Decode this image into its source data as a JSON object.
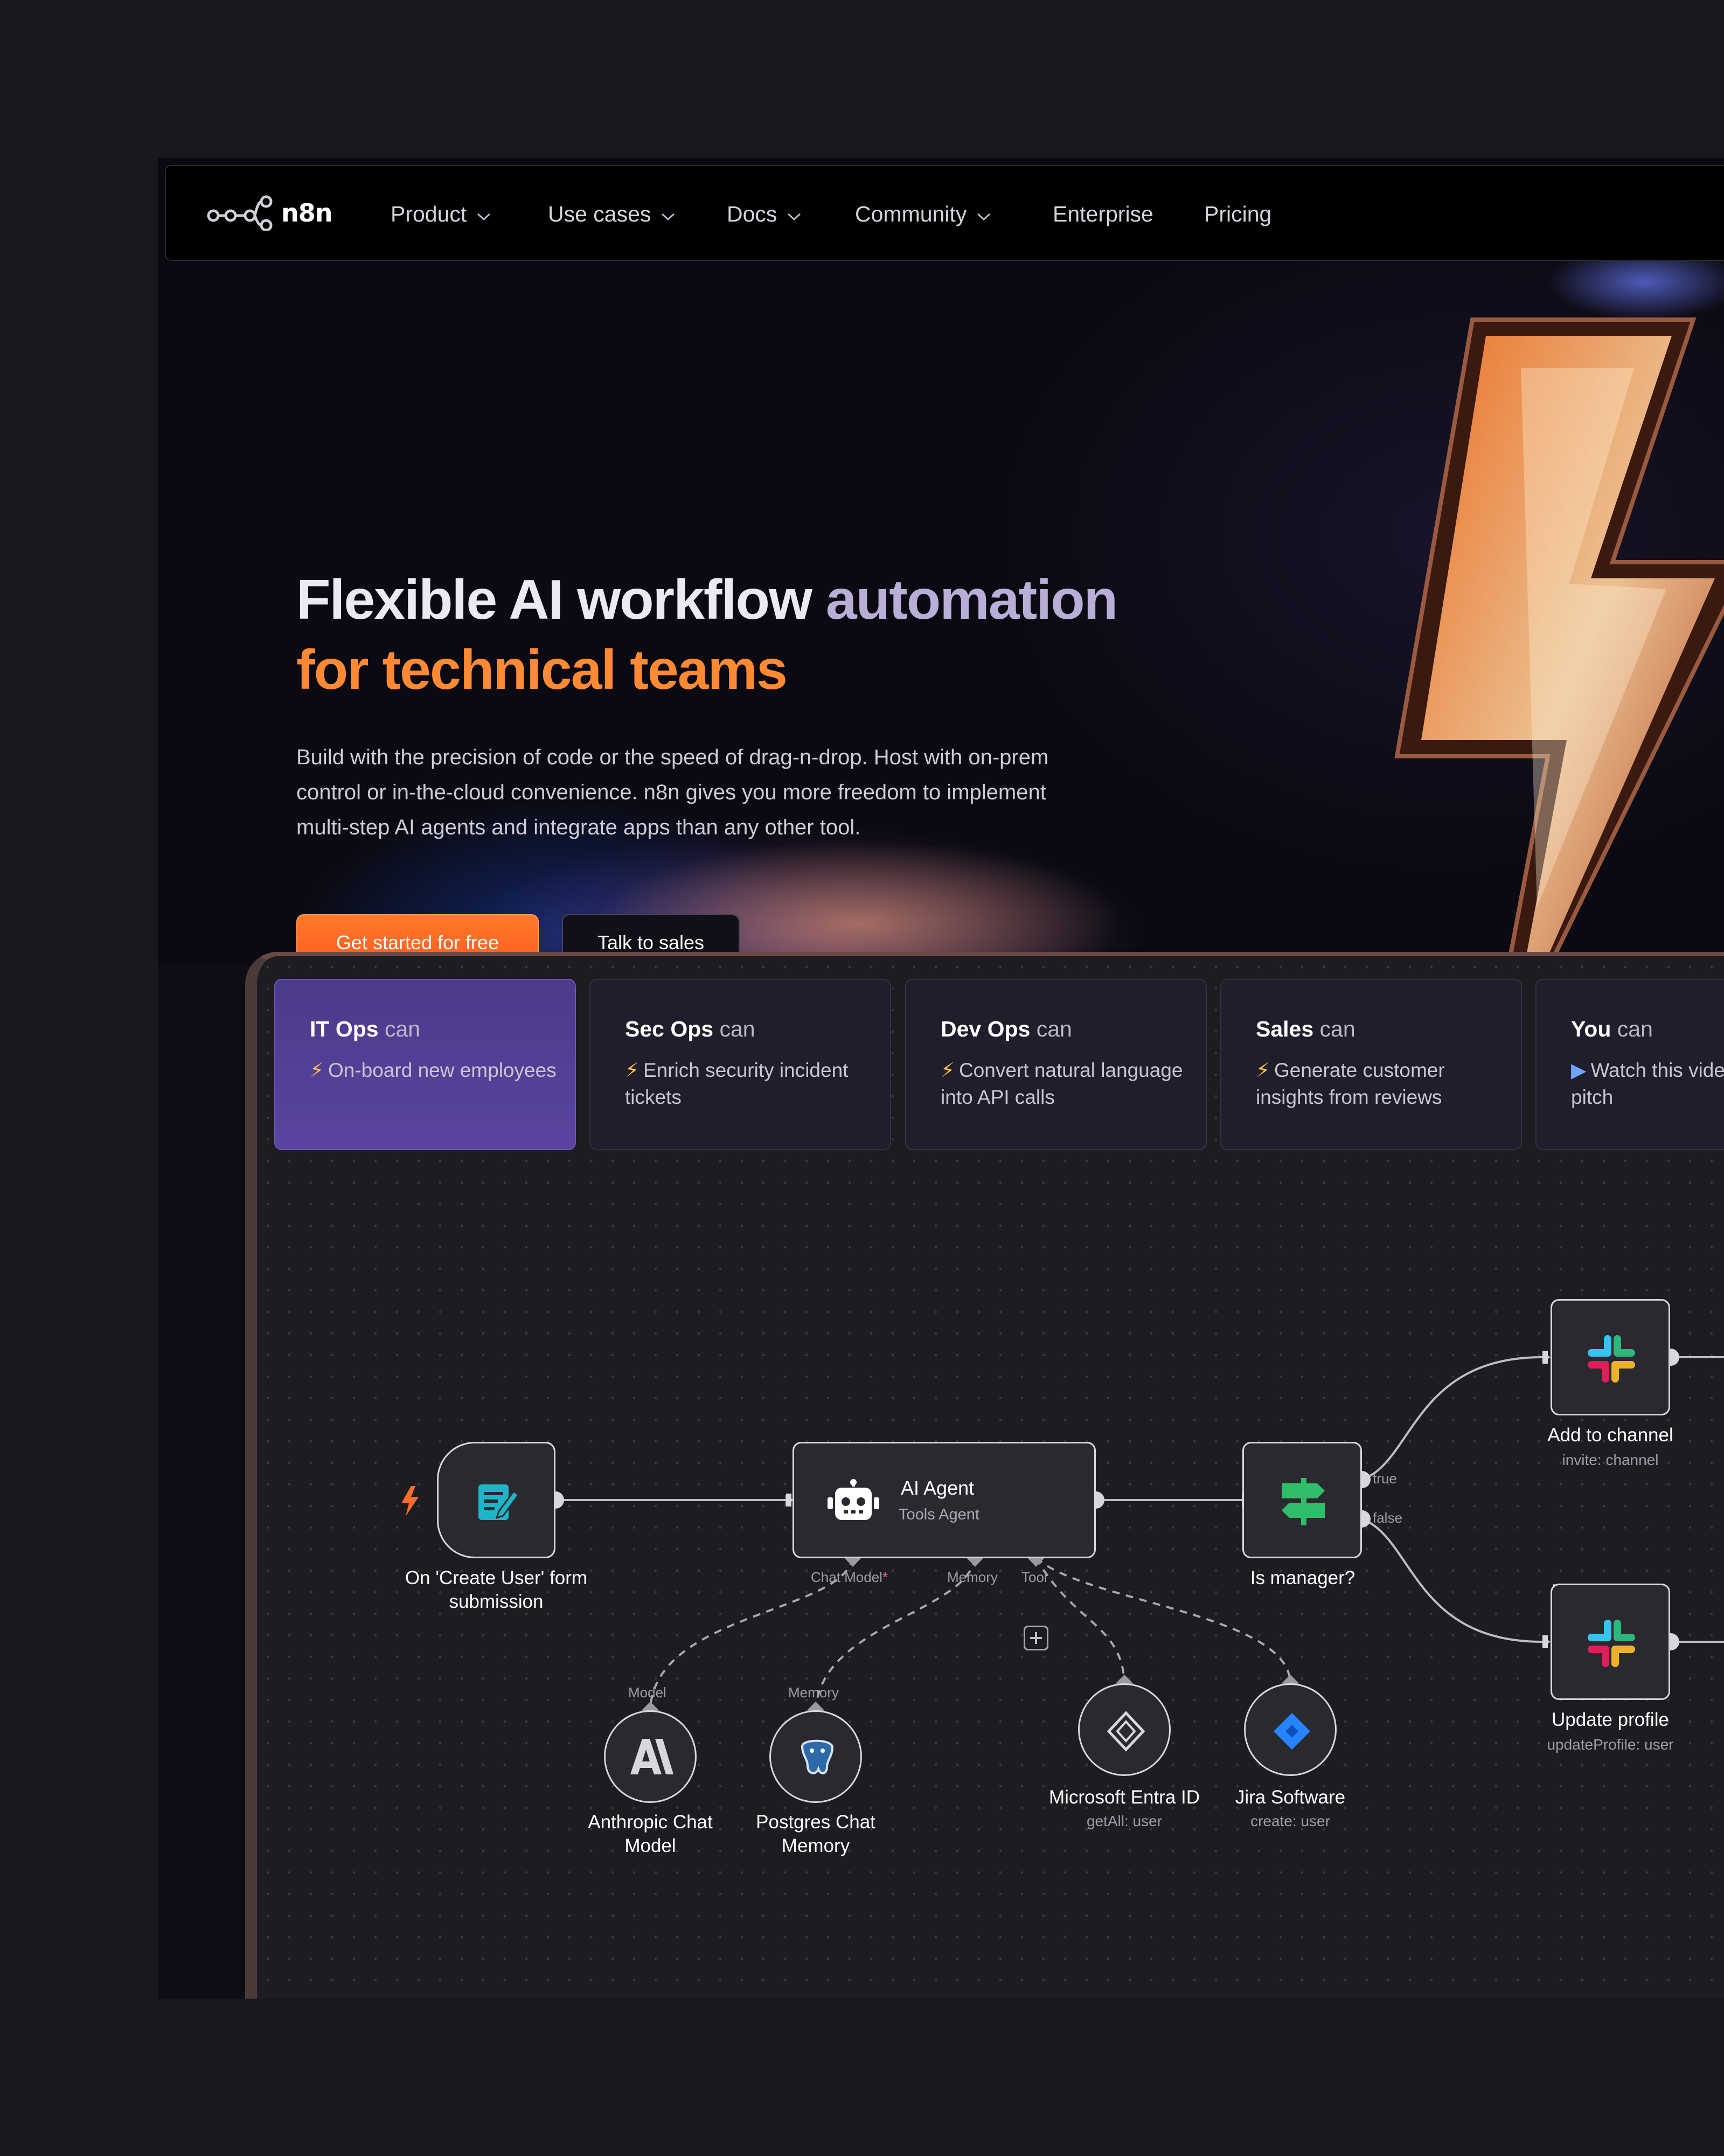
{
  "nav": {
    "brand": "n8n",
    "items": [
      {
        "label": "Product",
        "dropdown": true
      },
      {
        "label": "Use cases",
        "dropdown": true
      },
      {
        "label": "Docs",
        "dropdown": true
      },
      {
        "label": "Community",
        "dropdown": true
      },
      {
        "label": "Enterprise",
        "dropdown": false
      },
      {
        "label": "Pricing",
        "dropdown": false
      }
    ]
  },
  "hero": {
    "title_line1_a": "Flexible AI workflow ",
    "title_line1_b": "automation",
    "title_line2": "for technical teams",
    "description": "Build with the precision of code or the speed of drag-n-drop. Host with on-prem control or in-the-cloud convenience. n8n gives you more freedom to implement multi-step AI agents and integrate apps than any other tool.",
    "cta_primary": "Get started for free",
    "cta_secondary": "Talk to sales"
  },
  "tabs": [
    {
      "team": "IT Ops",
      "can": " can",
      "icon": "⚡",
      "desc": "On-board new employees",
      "active": true
    },
    {
      "team": "Sec Ops",
      "can": " can",
      "icon": "⚡",
      "desc": "Enrich security incident tickets",
      "active": false
    },
    {
      "team": "Dev Ops",
      "can": " can",
      "icon": "⚡",
      "desc": "Convert natural language into API calls",
      "active": false
    },
    {
      "team": "Sales",
      "can": " can",
      "icon": "⚡",
      "desc": "Generate customer insights from reviews",
      "active": false
    },
    {
      "team": "You",
      "can": " can",
      "icon": "▶",
      "desc": "Watch this video to hear our pitch",
      "active": false
    }
  ],
  "workflow": {
    "trigger": {
      "label": "On 'Create User' form submission"
    },
    "agent": {
      "title": "AI Agent",
      "subtitle": "Tools Agent",
      "port_chat": "Chat Model",
      "port_chat_req": "*",
      "port_memory": "Memory",
      "port_tool": "Tool"
    },
    "switch": {
      "label": "Is manager?",
      "branch_true": "true",
      "branch_false": "false"
    },
    "add_channel": {
      "label": "Add to channel",
      "sub": "invite: channel"
    },
    "update_profile": {
      "label": "Update profile",
      "sub": "updateProfile: user"
    },
    "anthropic": {
      "label": "Anthropic Chat Model",
      "port": "Model"
    },
    "postgres": {
      "label": "Postgres Chat Memory",
      "port": "Memory"
    },
    "entra": {
      "label": "Microsoft Entra ID",
      "sub": "getAll: user"
    },
    "jira": {
      "label": "Jira Software",
      "sub": "create: user"
    }
  },
  "colors": {
    "accent_orange": "#ff6d2a",
    "tab_active": "#5a44a0",
    "node_border": "#d8d7dc"
  },
  "icons": [
    "n8n-logo-icon",
    "chevron-down-icon",
    "lightning-bolt-icon",
    "form-icon",
    "robot-icon",
    "signpost-icon",
    "slack-icon",
    "anthropic-icon",
    "postgres-icon",
    "entra-icon",
    "jira-icon",
    "plus-icon"
  ]
}
